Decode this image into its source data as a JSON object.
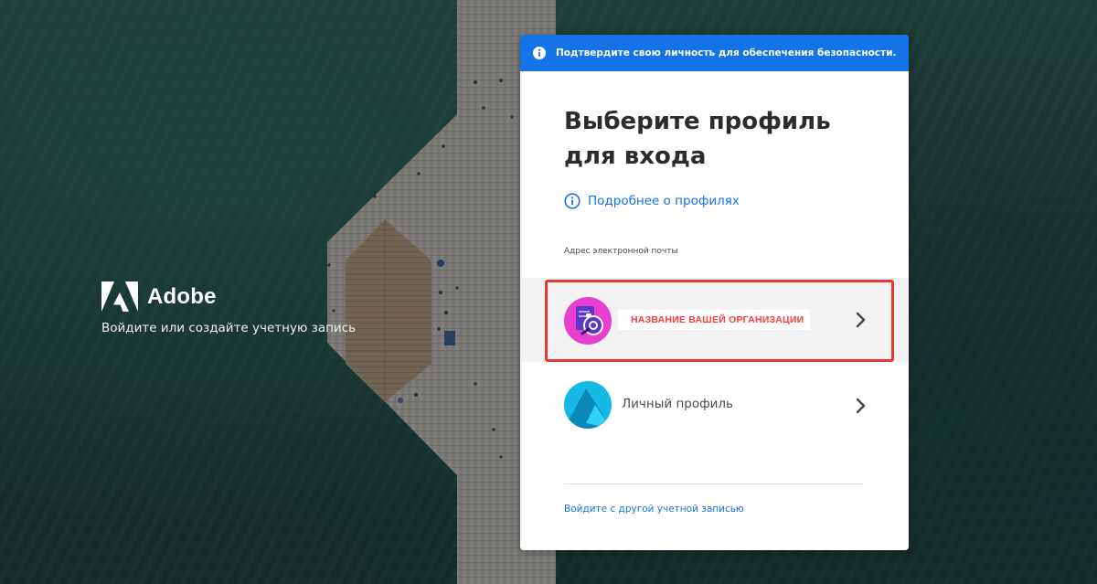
{
  "brand": {
    "name": "Adobe",
    "tagline": "Войдите или создайте учетную запись"
  },
  "banner": {
    "icon": "info-icon",
    "text": "Подтвердите свою личность для обеспечения безопасности."
  },
  "main": {
    "title": "Выберите профиль для входа",
    "learn_more": "Подробнее о профилях",
    "email_label": "Адрес электронной почты"
  },
  "profiles": [
    {
      "type": "organization",
      "name": "НАЗВАНИЕ ВАШЕЙ ОРГАНИЗАЦИИ",
      "icon": "org-avatar-icon",
      "highlighted": true
    },
    {
      "type": "personal",
      "name": "Личный профиль",
      "icon": "personal-avatar-icon"
    }
  ],
  "footer": {
    "switch_account": "Войдите с другой учетной записью"
  },
  "colors": {
    "accent": "#1473e6",
    "highlight": "#e53935",
    "org_name": "#ff3b3b"
  }
}
